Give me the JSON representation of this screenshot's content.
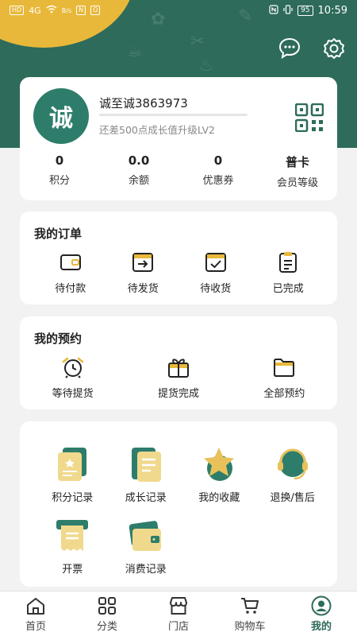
{
  "status_bar": {
    "network_chip": "HD",
    "signal": "4G",
    "speed_label": "B/s",
    "nfc_chip": "N",
    "vibrate_chip": "O",
    "battery": "95",
    "time": "10:59"
  },
  "profile": {
    "avatar_text": "诚",
    "username": "诚至诚3863973",
    "level_hint": "还差500点成长值升级LV2",
    "level_progress": 0.0,
    "stats": [
      {
        "value": "0",
        "label": "积分"
      },
      {
        "value": "0.0",
        "label": "余额"
      },
      {
        "value": "0",
        "label": "优惠券"
      },
      {
        "value": "普卡",
        "label": "会员等级"
      }
    ]
  },
  "orders": {
    "title": "我的订单",
    "items": [
      {
        "label": "待付款",
        "icon": "wallet-icon"
      },
      {
        "label": "待发货",
        "icon": "box-arrow-icon"
      },
      {
        "label": "待收货",
        "icon": "box-check-icon"
      },
      {
        "label": "已完成",
        "icon": "clipboard-icon"
      }
    ]
  },
  "booking": {
    "title": "我的预约",
    "items": [
      {
        "label": "等待提货",
        "icon": "alarm-clock-icon"
      },
      {
        "label": "提货完成",
        "icon": "gift-icon"
      },
      {
        "label": "全部预约",
        "icon": "folder-icon"
      }
    ]
  },
  "services": {
    "items": [
      {
        "label": "积分记录",
        "icon": "points-record-icon"
      },
      {
        "label": "成长记录",
        "icon": "growth-record-icon"
      },
      {
        "label": "我的收藏",
        "icon": "star-favorite-icon"
      },
      {
        "label": "退换/售后",
        "icon": "headset-service-icon"
      },
      {
        "label": "开票",
        "icon": "invoice-icon"
      },
      {
        "label": "消费记录",
        "icon": "wallet-record-icon"
      }
    ]
  },
  "tabbar": {
    "items": [
      {
        "label": "首页",
        "icon": "home-icon"
      },
      {
        "label": "分类",
        "icon": "grid-icon"
      },
      {
        "label": "门店",
        "icon": "store-icon"
      },
      {
        "label": "购物车",
        "icon": "cart-icon"
      },
      {
        "label": "我的",
        "icon": "profile-icon"
      }
    ],
    "active_index": 4
  },
  "colors": {
    "brand_green": "#2e6b5b",
    "accent_yellow": "#e8b83a",
    "background": "#f2f2f2"
  }
}
